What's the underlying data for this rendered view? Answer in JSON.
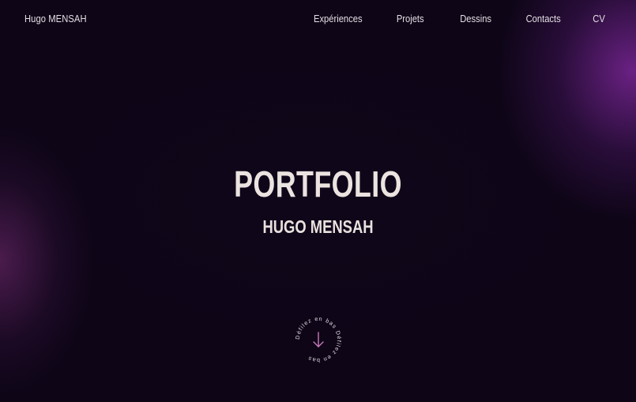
{
  "header": {
    "brand": "Hugo MENSAH",
    "nav": {
      "experiences": "Expériences",
      "projects": "Projets",
      "drawings": "Dessins",
      "contacts": "Contacts",
      "cv": "CV"
    }
  },
  "hero": {
    "title": "PORTFOLIO",
    "subtitle": "HUGO MENSAH"
  },
  "scroll_indicator": {
    "ring_text": "Défilez en bas Défilez en bas",
    "icon": "arrow-down-icon"
  },
  "colors": {
    "background": "#0d0614",
    "glow_purple": "#7a2696",
    "glow_magenta": "#5f235f",
    "text": "#e9e2e6",
    "accent": "#c77bb8"
  }
}
